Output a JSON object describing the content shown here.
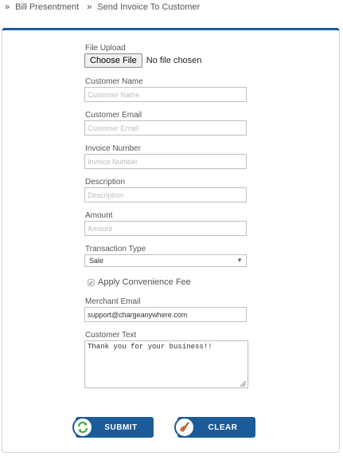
{
  "breadcrumb": {
    "items": [
      "Bill Presentment",
      "Send Invoice To Customer"
    ],
    "separator": "»"
  },
  "form": {
    "file_upload": {
      "label": "File Upload",
      "button": "Choose File",
      "status": "No file chosen"
    },
    "customer_name": {
      "label": "Customer Name",
      "placeholder": "Customer Name",
      "value": ""
    },
    "customer_email": {
      "label": "Customer Email",
      "placeholder": "Customer Email",
      "value": ""
    },
    "invoice_number": {
      "label": "Invoice Number",
      "placeholder": "Invoice Number",
      "value": ""
    },
    "description": {
      "label": "Description",
      "placeholder": "Description",
      "value": ""
    },
    "amount": {
      "label": "Amount",
      "placeholder": "Amount",
      "value": ""
    },
    "transaction_type": {
      "label": "Transaction Type",
      "selected": "Sale",
      "caret": "▼"
    },
    "convenience_fee": {
      "label": "Apply Convenience Fee",
      "checked": true,
      "check_mark": "✔"
    },
    "merchant_email": {
      "label": "Merchant Email",
      "value": "support@chargeanywhere.com"
    },
    "customer_text": {
      "label": "Customer Text",
      "value": "Thank you for your business!!"
    }
  },
  "buttons": {
    "submit": {
      "label": "SUBMIT",
      "icon": "refresh-icon"
    },
    "clear": {
      "label": "CLEAR",
      "icon": "broom-icon"
    }
  },
  "colors": {
    "accent": "#1b5b9a",
    "border": "#bfbfbf",
    "placeholder": "#bdbdbd",
    "submit_icon": "#3aa935",
    "clear_icon": "#c0632a"
  }
}
